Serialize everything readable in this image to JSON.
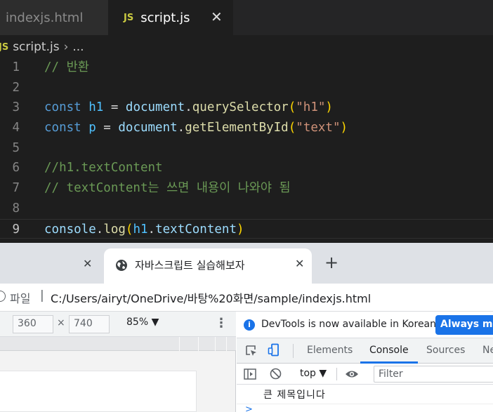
{
  "editor": {
    "tabs": [
      {
        "label": "indexjs.html"
      },
      {
        "label": "script.js",
        "badge": "JS",
        "close": "✕"
      }
    ],
    "breadcrumb": {
      "badge": "JS",
      "file": "script.js",
      "separator": "›",
      "rest": "..."
    },
    "lines": [
      {
        "n": "1",
        "parts": [
          {
            "t": "// 반환",
            "c": "c-comment"
          }
        ]
      },
      {
        "n": "2",
        "parts": []
      },
      {
        "n": "3",
        "parts": [
          {
            "t": "const ",
            "c": "c-kw"
          },
          {
            "t": "h1",
            "c": "c-var"
          },
          {
            "t": " = ",
            "c": "c-plain"
          },
          {
            "t": "document",
            "c": "c-obj"
          },
          {
            "t": ".",
            "c": "c-plain"
          },
          {
            "t": "querySelector",
            "c": "c-fn"
          },
          {
            "t": "(",
            "c": "c-paren"
          },
          {
            "t": "\"h1\"",
            "c": "c-str"
          },
          {
            "t": ")",
            "c": "c-paren"
          }
        ]
      },
      {
        "n": "4",
        "parts": [
          {
            "t": "const ",
            "c": "c-kw"
          },
          {
            "t": "p",
            "c": "c-var"
          },
          {
            "t": " = ",
            "c": "c-plain"
          },
          {
            "t": "document",
            "c": "c-obj"
          },
          {
            "t": ".",
            "c": "c-plain"
          },
          {
            "t": "getElementById",
            "c": "c-fn"
          },
          {
            "t": "(",
            "c": "c-paren"
          },
          {
            "t": "\"text\"",
            "c": "c-str"
          },
          {
            "t": ")",
            "c": "c-paren"
          }
        ]
      },
      {
        "n": "5",
        "parts": []
      },
      {
        "n": "6",
        "parts": [
          {
            "t": "//h1.textContent",
            "c": "c-comment"
          }
        ]
      },
      {
        "n": "7",
        "parts": [
          {
            "t": "// textContent는 쓰면 내용이 나와야 됨",
            "c": "c-comment"
          }
        ]
      },
      {
        "n": "8",
        "parts": []
      },
      {
        "n": "9",
        "current": true,
        "parts": [
          {
            "t": "console",
            "c": "c-obj"
          },
          {
            "t": ".",
            "c": "c-plain"
          },
          {
            "t": "log",
            "c": "c-fn"
          },
          {
            "t": "(",
            "c": "c-paren"
          },
          {
            "t": "h1",
            "c": "c-var"
          },
          {
            "t": ".",
            "c": "c-plain"
          },
          {
            "t": "textContent",
            "c": "c-obj"
          },
          {
            "t": ")",
            "c": "c-paren"
          }
        ]
      }
    ]
  },
  "browser": {
    "prev_tab_close": "✕",
    "active_tab": {
      "title": "자바스크립트 실습해보자",
      "close": "✕"
    },
    "new_tab": "+",
    "address": {
      "scheme": "파일",
      "separator": "|",
      "url": "C:/Users/airyt/OneDrive/바탕%20화면/sample/indexjs.html"
    },
    "device_toolbar": {
      "width": "360",
      "times": "×",
      "height": "740",
      "zoom": "85% ▼",
      "more": "⋮"
    }
  },
  "devtools": {
    "banner": {
      "text": "DevTools is now available in Korean!",
      "button": "Always match Chrome's language"
    },
    "tabs": [
      "Elements",
      "Console",
      "Sources",
      "Network"
    ],
    "console_toolbar": {
      "context": "top ▼",
      "filter_placeholder": "Filter"
    },
    "log": [
      "큰 제목입니다"
    ],
    "prompt": ">"
  }
}
